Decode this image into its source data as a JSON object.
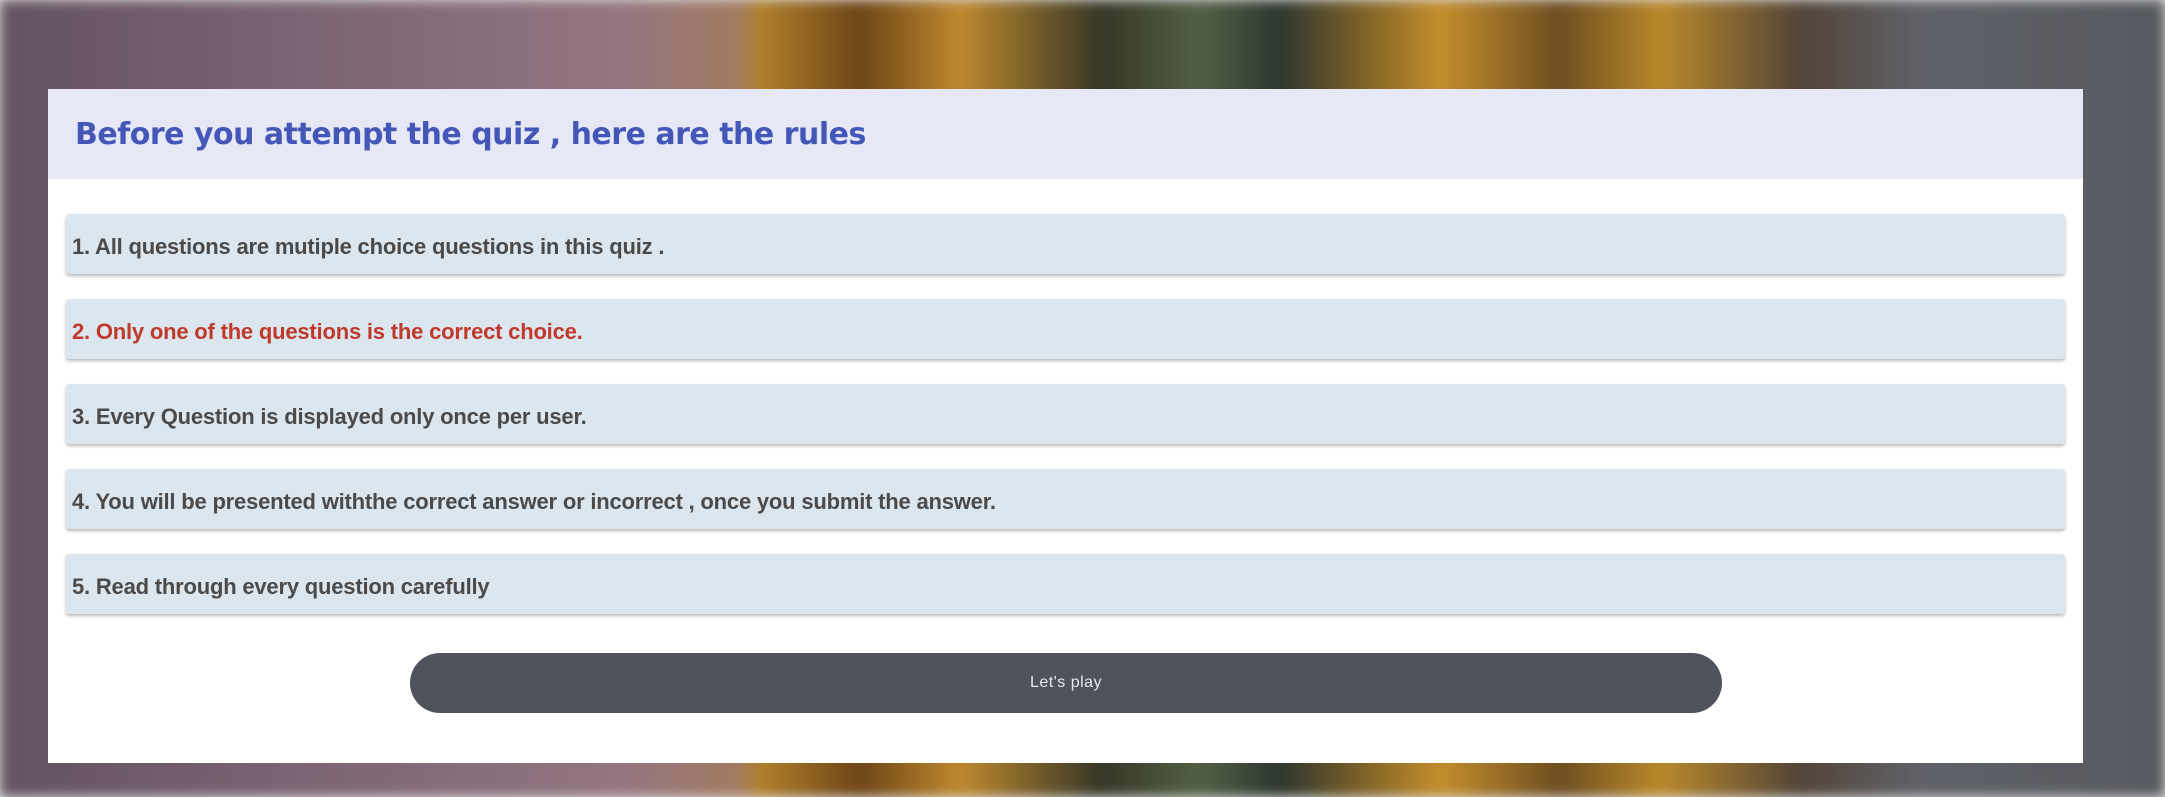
{
  "dialog": {
    "title": "Before you attempt the quiz , here are the rules"
  },
  "rules": [
    {
      "text": "1. All questions are mutiple choice questions in this quiz .",
      "highlighted": false
    },
    {
      "text": "2. Only one of the questions is the correct choice.",
      "highlighted": true
    },
    {
      "text": "3. Every Question is displayed only once per user.",
      "highlighted": false
    },
    {
      "text": "4. You will be presented withthe correct answer or incorrect , once you submit the answer.",
      "highlighted": false
    },
    {
      "text": "5. Read through every question carefully",
      "highlighted": false
    }
  ],
  "actions": {
    "play_label": "Let's play"
  },
  "colors": {
    "title": "#4457b8",
    "header_bg": "#e6e8f5",
    "rule_bg": "#dce6ee",
    "rule_text": "#4a4a4a",
    "highlight_text": "#c0392b",
    "button_bg": "#50525c"
  }
}
